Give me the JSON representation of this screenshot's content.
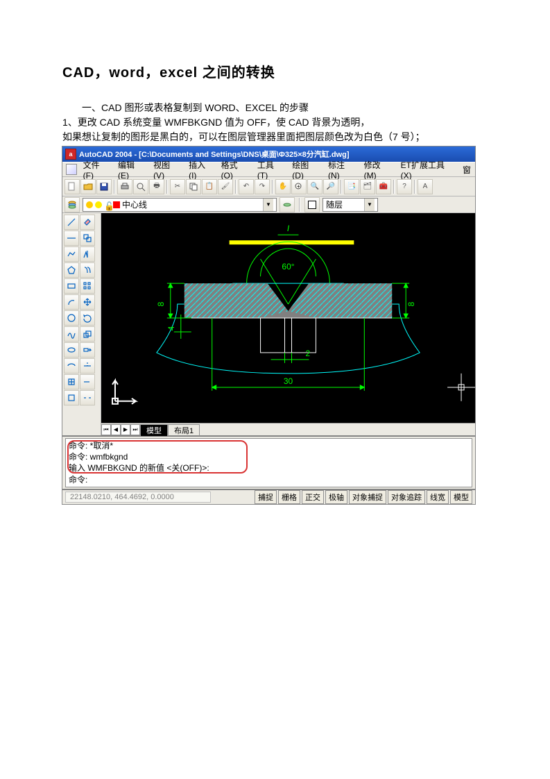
{
  "doc": {
    "title": "CAD，word，excel 之间的转换",
    "p1": "一、CAD 图形或表格复制到 WORD、EXCEL 的步骤",
    "p2": "1、更改 CAD 系统变量 WMFBKGND 值为 OFF，使 CAD 背景为透明，",
    "p3": "如果想让复制的图形是黑白的，可以在图层管理器里面把图层颜色改为白色（7 号）；"
  },
  "app": {
    "title": "AutoCAD 2004 - [C:\\Documents and Settings\\DNS\\桌面\\Φ325×8分汽缸.dwg]",
    "icon_letter": "a",
    "menu": {
      "file": "文件(F)",
      "edit": "编辑(E)",
      "view": "视图(V)",
      "insert": "插入(I)",
      "format": "格式(O)",
      "tools": "工具(T)",
      "draw": "绘图(D)",
      "dimension": "标注(N)",
      "modify": "修改(M)",
      "ext": "ET扩展工具(X)",
      "window": "窗"
    },
    "layer": {
      "current": "中心线",
      "style": "随层"
    },
    "tabs": {
      "model": "模型",
      "layout1": "布局1"
    },
    "drawing": {
      "label_top": "I",
      "angle": "60°",
      "dim_left": "8",
      "dim_left2": "4",
      "dim_right": "8",
      "dim_gap": "2",
      "dim_width": "30"
    },
    "cmd": {
      "l1": "命令: *取消*",
      "l2": "命令: wmfbkgnd",
      "l3": "输入 WMFBKGND 的新值 <关(OFF)>:",
      "l4": "命令:"
    },
    "status": {
      "coords": "22148.0210, 464.4692, 0.0000",
      "snap": "捕捉",
      "grid": "栅格",
      "ortho": "正交",
      "polar": "极轴",
      "osnap": "对象捕捉",
      "otrack": "对象追踪",
      "lwt": "线宽",
      "model": "模型"
    }
  }
}
